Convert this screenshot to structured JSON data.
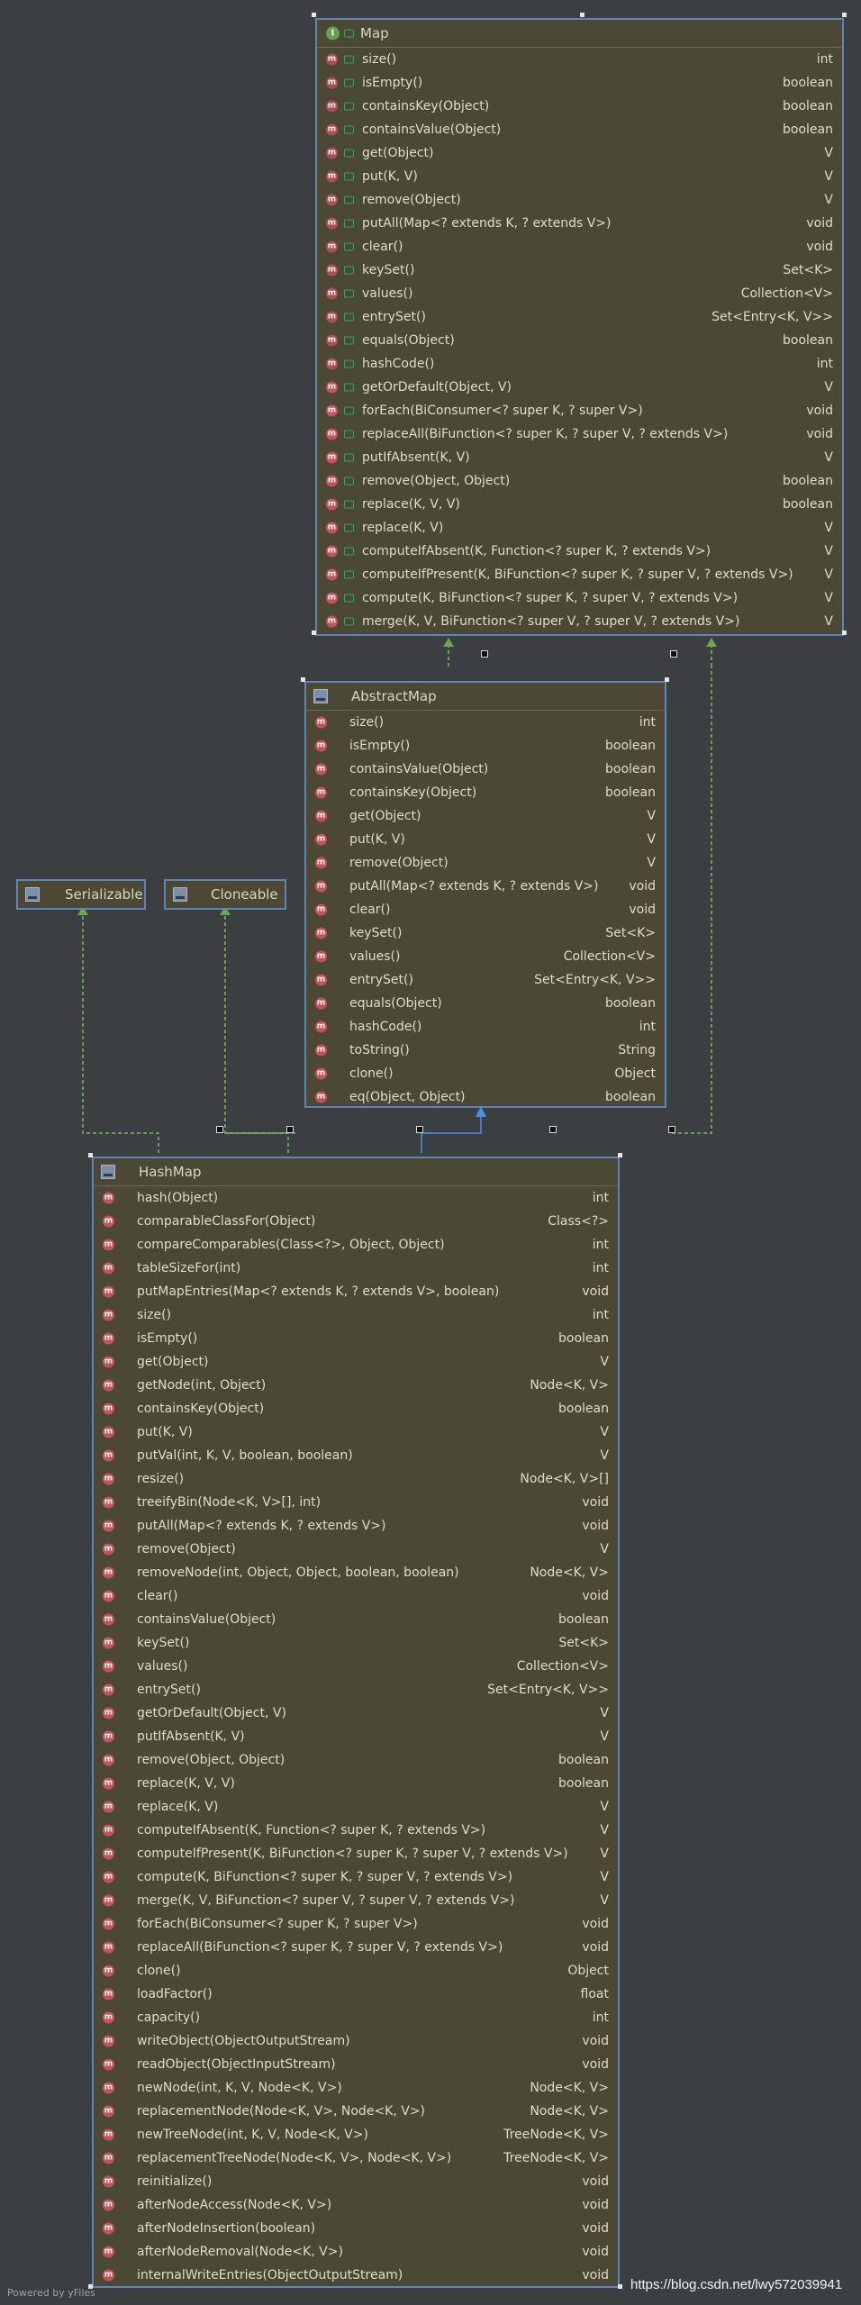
{
  "map": {
    "title": "Map",
    "methods": [
      {
        "name": "size()",
        "type": "int"
      },
      {
        "name": "isEmpty()",
        "type": "boolean"
      },
      {
        "name": "containsKey(Object)",
        "type": "boolean"
      },
      {
        "name": "containsValue(Object)",
        "type": "boolean"
      },
      {
        "name": "get(Object)",
        "type": "V"
      },
      {
        "name": "put(K, V)",
        "type": "V"
      },
      {
        "name": "remove(Object)",
        "type": "V"
      },
      {
        "name": "putAll(Map<? extends K, ? extends V>)",
        "type": "void"
      },
      {
        "name": "clear()",
        "type": "void"
      },
      {
        "name": "keySet()",
        "type": "Set<K>"
      },
      {
        "name": "values()",
        "type": "Collection<V>"
      },
      {
        "name": "entrySet()",
        "type": "Set<Entry<K, V>>"
      },
      {
        "name": "equals(Object)",
        "type": "boolean"
      },
      {
        "name": "hashCode()",
        "type": "int"
      },
      {
        "name": "getOrDefault(Object, V)",
        "type": "V"
      },
      {
        "name": "forEach(BiConsumer<? super K, ? super V>)",
        "type": "void"
      },
      {
        "name": "replaceAll(BiFunction<? super K, ? super V, ? extends V>)",
        "type": "void"
      },
      {
        "name": "putIfAbsent(K, V)",
        "type": "V"
      },
      {
        "name": "remove(Object, Object)",
        "type": "boolean"
      },
      {
        "name": "replace(K, V, V)",
        "type": "boolean"
      },
      {
        "name": "replace(K, V)",
        "type": "V"
      },
      {
        "name": "computeIfAbsent(K, Function<? super K, ? extends V>)",
        "type": "V"
      },
      {
        "name": "computeIfPresent(K, BiFunction<? super K, ? super V, ? extends V>)",
        "type": "V"
      },
      {
        "name": "compute(K, BiFunction<? super K, ? super V, ? extends V>)",
        "type": "V"
      },
      {
        "name": "merge(K, V, BiFunction<? super V, ? super V, ? extends V>)",
        "type": "V"
      }
    ]
  },
  "abstract_map": {
    "title": "AbstractMap",
    "methods": [
      {
        "name": "size()",
        "type": "int"
      },
      {
        "name": "isEmpty()",
        "type": "boolean"
      },
      {
        "name": "containsValue(Object)",
        "type": "boolean"
      },
      {
        "name": "containsKey(Object)",
        "type": "boolean"
      },
      {
        "name": "get(Object)",
        "type": "V"
      },
      {
        "name": "put(K, V)",
        "type": "V"
      },
      {
        "name": "remove(Object)",
        "type": "V"
      },
      {
        "name": "putAll(Map<? extends K, ? extends V>)",
        "type": "void"
      },
      {
        "name": "clear()",
        "type": "void"
      },
      {
        "name": "keySet()",
        "type": "Set<K>"
      },
      {
        "name": "values()",
        "type": "Collection<V>"
      },
      {
        "name": "entrySet()",
        "type": "Set<Entry<K, V>>"
      },
      {
        "name": "equals(Object)",
        "type": "boolean"
      },
      {
        "name": "hashCode()",
        "type": "int"
      },
      {
        "name": "toString()",
        "type": "String"
      },
      {
        "name": "clone()",
        "type": "Object"
      },
      {
        "name": "eq(Object, Object)",
        "type": "boolean"
      }
    ]
  },
  "serializable": {
    "title": "Serializable"
  },
  "cloneable": {
    "title": "Cloneable"
  },
  "hash_map": {
    "title": "HashMap",
    "methods": [
      {
        "name": "hash(Object)",
        "type": "int"
      },
      {
        "name": "comparableClassFor(Object)",
        "type": "Class<?>"
      },
      {
        "name": "compareComparables(Class<?>, Object, Object)",
        "type": "int"
      },
      {
        "name": "tableSizeFor(int)",
        "type": "int"
      },
      {
        "name": "putMapEntries(Map<? extends K, ? extends V>, boolean)",
        "type": "void"
      },
      {
        "name": "size()",
        "type": "int"
      },
      {
        "name": "isEmpty()",
        "type": "boolean"
      },
      {
        "name": "get(Object)",
        "type": "V"
      },
      {
        "name": "getNode(int, Object)",
        "type": "Node<K, V>"
      },
      {
        "name": "containsKey(Object)",
        "type": "boolean"
      },
      {
        "name": "put(K, V)",
        "type": "V"
      },
      {
        "name": "putVal(int, K, V, boolean, boolean)",
        "type": "V"
      },
      {
        "name": "resize()",
        "type": "Node<K, V>[]"
      },
      {
        "name": "treeifyBin(Node<K, V>[], int)",
        "type": "void"
      },
      {
        "name": "putAll(Map<? extends K, ? extends V>)",
        "type": "void"
      },
      {
        "name": "remove(Object)",
        "type": "V"
      },
      {
        "name": "removeNode(int, Object, Object, boolean, boolean)",
        "type": "Node<K, V>"
      },
      {
        "name": "clear()",
        "type": "void"
      },
      {
        "name": "containsValue(Object)",
        "type": "boolean"
      },
      {
        "name": "keySet()",
        "type": "Set<K>"
      },
      {
        "name": "values()",
        "type": "Collection<V>"
      },
      {
        "name": "entrySet()",
        "type": "Set<Entry<K, V>>"
      },
      {
        "name": "getOrDefault(Object, V)",
        "type": "V"
      },
      {
        "name": "putIfAbsent(K, V)",
        "type": "V"
      },
      {
        "name": "remove(Object, Object)",
        "type": "boolean"
      },
      {
        "name": "replace(K, V, V)",
        "type": "boolean"
      },
      {
        "name": "replace(K, V)",
        "type": "V"
      },
      {
        "name": "computeIfAbsent(K, Function<? super K, ? extends V>)",
        "type": "V"
      },
      {
        "name": "computeIfPresent(K, BiFunction<? super K, ? super V, ? extends V>)",
        "type": "V"
      },
      {
        "name": "compute(K, BiFunction<? super K, ? super V, ? extends V>)",
        "type": "V"
      },
      {
        "name": "merge(K, V, BiFunction<? super V, ? super V, ? extends V>)",
        "type": "V"
      },
      {
        "name": "forEach(BiConsumer<? super K, ? super V>)",
        "type": "void"
      },
      {
        "name": "replaceAll(BiFunction<? super K, ? super V, ? extends V>)",
        "type": "void"
      },
      {
        "name": "clone()",
        "type": "Object"
      },
      {
        "name": "loadFactor()",
        "type": "float"
      },
      {
        "name": "capacity()",
        "type": "int"
      },
      {
        "name": "writeObject(ObjectOutputStream)",
        "type": "void"
      },
      {
        "name": "readObject(ObjectInputStream)",
        "type": "void"
      },
      {
        "name": "newNode(int, K, V, Node<K, V>)",
        "type": "Node<K, V>"
      },
      {
        "name": "replacementNode(Node<K, V>, Node<K, V>)",
        "type": "Node<K, V>"
      },
      {
        "name": "newTreeNode(int, K, V, Node<K, V>)",
        "type": "TreeNode<K, V>"
      },
      {
        "name": "replacementTreeNode(Node<K, V>, Node<K, V>)",
        "type": "TreeNode<K, V>"
      },
      {
        "name": "reinitialize()",
        "type": "void"
      },
      {
        "name": "afterNodeAccess(Node<K, V>)",
        "type": "void"
      },
      {
        "name": "afterNodeInsertion(boolean)",
        "type": "void"
      },
      {
        "name": "afterNodeRemoval(Node<K, V>)",
        "type": "void"
      },
      {
        "name": "internalWriteEntries(ObjectOutputStream)",
        "type": "void"
      }
    ]
  },
  "footer": {
    "powered": "Powered by yFiles",
    "url": "https://blog.csdn.net/lwy572039941"
  },
  "colors": {
    "background": "#3c3f41",
    "box_fill": "#4b4935",
    "box_border": "#5e84b8",
    "implements_line": "#6aa84f",
    "extends_line": "#4a8fe7"
  }
}
